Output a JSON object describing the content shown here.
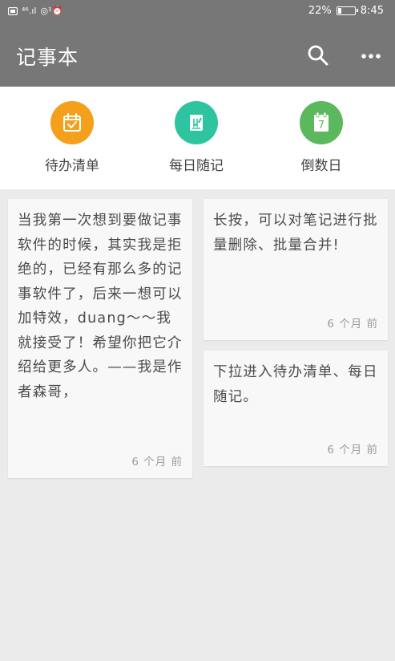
{
  "status_bar": {
    "network": "⁴⁶.ıl",
    "extra_icons": "◎¹⏰",
    "battery_percent": "22%",
    "battery_level": 0.22,
    "time": "8:45"
  },
  "app_bar": {
    "title": "记事本",
    "search_icon": "search-icon",
    "more_icon": "more-icon"
  },
  "shortcuts": [
    {
      "label": "待办清单",
      "color": "#f4a01c",
      "icon": "todo-icon"
    },
    {
      "label": "每日随记",
      "color": "#2ec4a0",
      "icon": "diary-icon"
    },
    {
      "label": "倒数日",
      "color": "#5cb85c",
      "icon": "countdown-icon",
      "icon_text": "7"
    }
  ],
  "notes": [
    {
      "text": "当我第一次想到要做记事软件的时候，其实我是拒绝的，已经有那么多的记事软件了，后来一想可以加特效，duang～～我就接受了！希望你把它介绍给更多人。——我是作者森哥，",
      "time": "6 个月 前"
    },
    {
      "text": "长按，可以对笔记进行批量删除、批量合并!",
      "time": "6 个月 前"
    },
    {
      "text": "下拉进入待办清单、每日随记。",
      "time": "6 个月 前"
    }
  ]
}
